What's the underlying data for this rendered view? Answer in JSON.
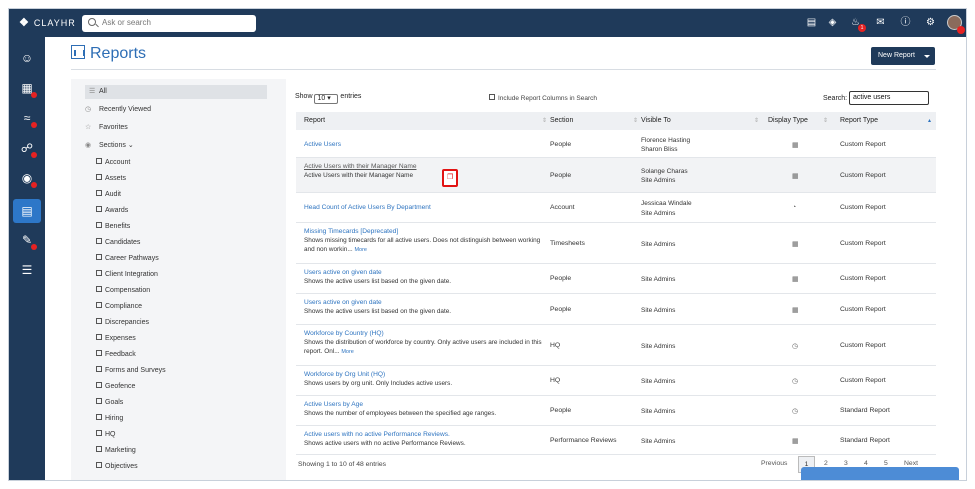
{
  "app": {
    "logo": "CLAY",
    "logo_suffix": "HR",
    "search_placeholder": "Ask or search",
    "notification_count": "1"
  },
  "header_icons": [
    "clipboard-icon",
    "layers-icon",
    "bell-icon",
    "mail-icon",
    "help-icon",
    "settings-icon"
  ],
  "sidebar_icons": [
    "people-icon",
    "timesheet-icon",
    "analytics-icon",
    "goals-icon",
    "profile-icon",
    "reports-icon",
    "training-icon",
    "forms-icon"
  ],
  "page": {
    "title": "Reports",
    "new_button": "New Report"
  },
  "categories": {
    "all": "All",
    "recent": "Recently Viewed",
    "favorites": "Favorites",
    "sections": "Sections",
    "subs": [
      "Account",
      "Assets",
      "Audit",
      "Awards",
      "Benefits",
      "Candidates",
      "Career Pathways",
      "Client Integration",
      "Compensation",
      "Compliance",
      "Discrepancies",
      "Expenses",
      "Feedback",
      "Forms and Surveys",
      "Geofence",
      "Goals",
      "Hiring",
      "HQ",
      "Marketing",
      "Objectives"
    ]
  },
  "table_controls": {
    "show_label": "Show",
    "show_value": "10",
    "entries_label": "entries",
    "include_label": "Include Report Columns in Search",
    "search_label": "Search:",
    "search_value": "active users"
  },
  "columns": [
    "Report",
    "Section",
    "Visible To",
    "Display Type",
    "Report Type"
  ],
  "rows": [
    {
      "title": "Active Users",
      "desc": "",
      "more": "",
      "section": "People",
      "visible": "Florence Hasting",
      "visible2": "Sharon Bliss",
      "type": "Custom Report",
      "icon": "table-icon"
    },
    {
      "title": "Active Users with their Manager Name",
      "desc": "Active Users with their Manager Name",
      "more": "",
      "section": "People",
      "visible": "Solange Charas",
      "visible2": "Site Admins",
      "type": "Custom Report",
      "icon": "table-icon"
    },
    {
      "title": "Head Count of Active Users By Department",
      "desc": "",
      "more": "",
      "section": "Account",
      "visible": "Jessicaa Windale",
      "visible2": "Site Admins",
      "type": "Custom Report",
      "icon": "pie-chart-icon"
    },
    {
      "title": "Missing Timecards [Deprecated]",
      "desc": "Shows missing timecards for all active users. Does not distinguish between working and non workin...",
      "more": "More",
      "section": "Timesheets",
      "visible": "Site Admins",
      "visible2": "",
      "type": "Custom Report",
      "icon": "table-icon"
    },
    {
      "title": "Users active on given date",
      "desc": "Shows the active users list based on the given date.",
      "more": "",
      "section": "People",
      "visible": "Site Admins",
      "visible2": "",
      "type": "Custom Report",
      "icon": "table-icon"
    },
    {
      "title": "Users active on given date",
      "desc": "Shows the active users list based on the given date.",
      "more": "",
      "section": "People",
      "visible": "Site Admins",
      "visible2": "",
      "type": "Custom Report",
      "icon": "table-icon"
    },
    {
      "title": "Workforce by Country (HQ)",
      "desc": "Shows the distribution of workforce by country. Only active users are included in this report. Onl...",
      "more": "More",
      "section": "HQ",
      "visible": "Site Admins",
      "visible2": "",
      "type": "Custom Report",
      "icon": "pie-outline-icon"
    },
    {
      "title": "Workforce by Org Unit (HQ)",
      "desc": "Shows users by org unit. Only Includes active users.",
      "more": "",
      "section": "HQ",
      "visible": "Site Admins",
      "visible2": "",
      "type": "Custom Report",
      "icon": "pie-outline-icon"
    },
    {
      "title": "Active Users by Age",
      "desc": "Shows the number of employees between the specified age ranges.",
      "more": "",
      "section": "People",
      "visible": "Site Admins",
      "visible2": "",
      "type": "Standard Report",
      "icon": "pie-outline-icon"
    },
    {
      "title": "Active users with no active Performance Reviews.",
      "desc": "Shows active users with no active Performance Reviews.",
      "more": "",
      "section": "Performance Reviews",
      "visible": "Site Admins",
      "visible2": "",
      "type": "Standard Report",
      "icon": "table-icon"
    }
  ],
  "footer": {
    "showing": "Showing 1 to 10 of 48 entries",
    "previous": "Previous",
    "pages": [
      "1",
      "2",
      "3",
      "4",
      "5"
    ],
    "next": "Next"
  },
  "colors": {
    "nav": "#1f3a5a",
    "accent": "#2e74c0",
    "highlight": "#e21313"
  }
}
